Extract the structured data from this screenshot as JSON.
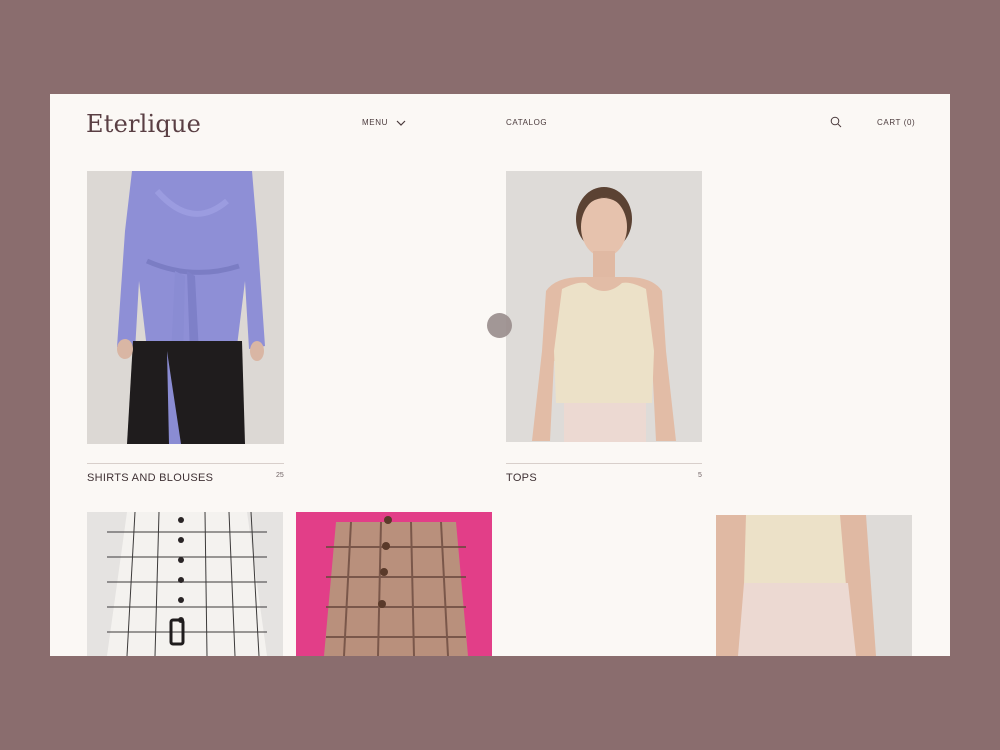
{
  "header": {
    "logo": "Eterlique",
    "menu_label": "MENU",
    "catalog_label": "CATALOG",
    "search_icon": "search-icon",
    "cart_label": "CART (0)"
  },
  "categories": [
    {
      "title": "SHIRTS AND BLOUSES",
      "count": "25"
    },
    {
      "title": "TOPS",
      "count": "5"
    }
  ],
  "colors": {
    "outer_bg": "#8a6d6e",
    "page_bg": "#fbf8f5",
    "brand": "#5a3f44"
  }
}
